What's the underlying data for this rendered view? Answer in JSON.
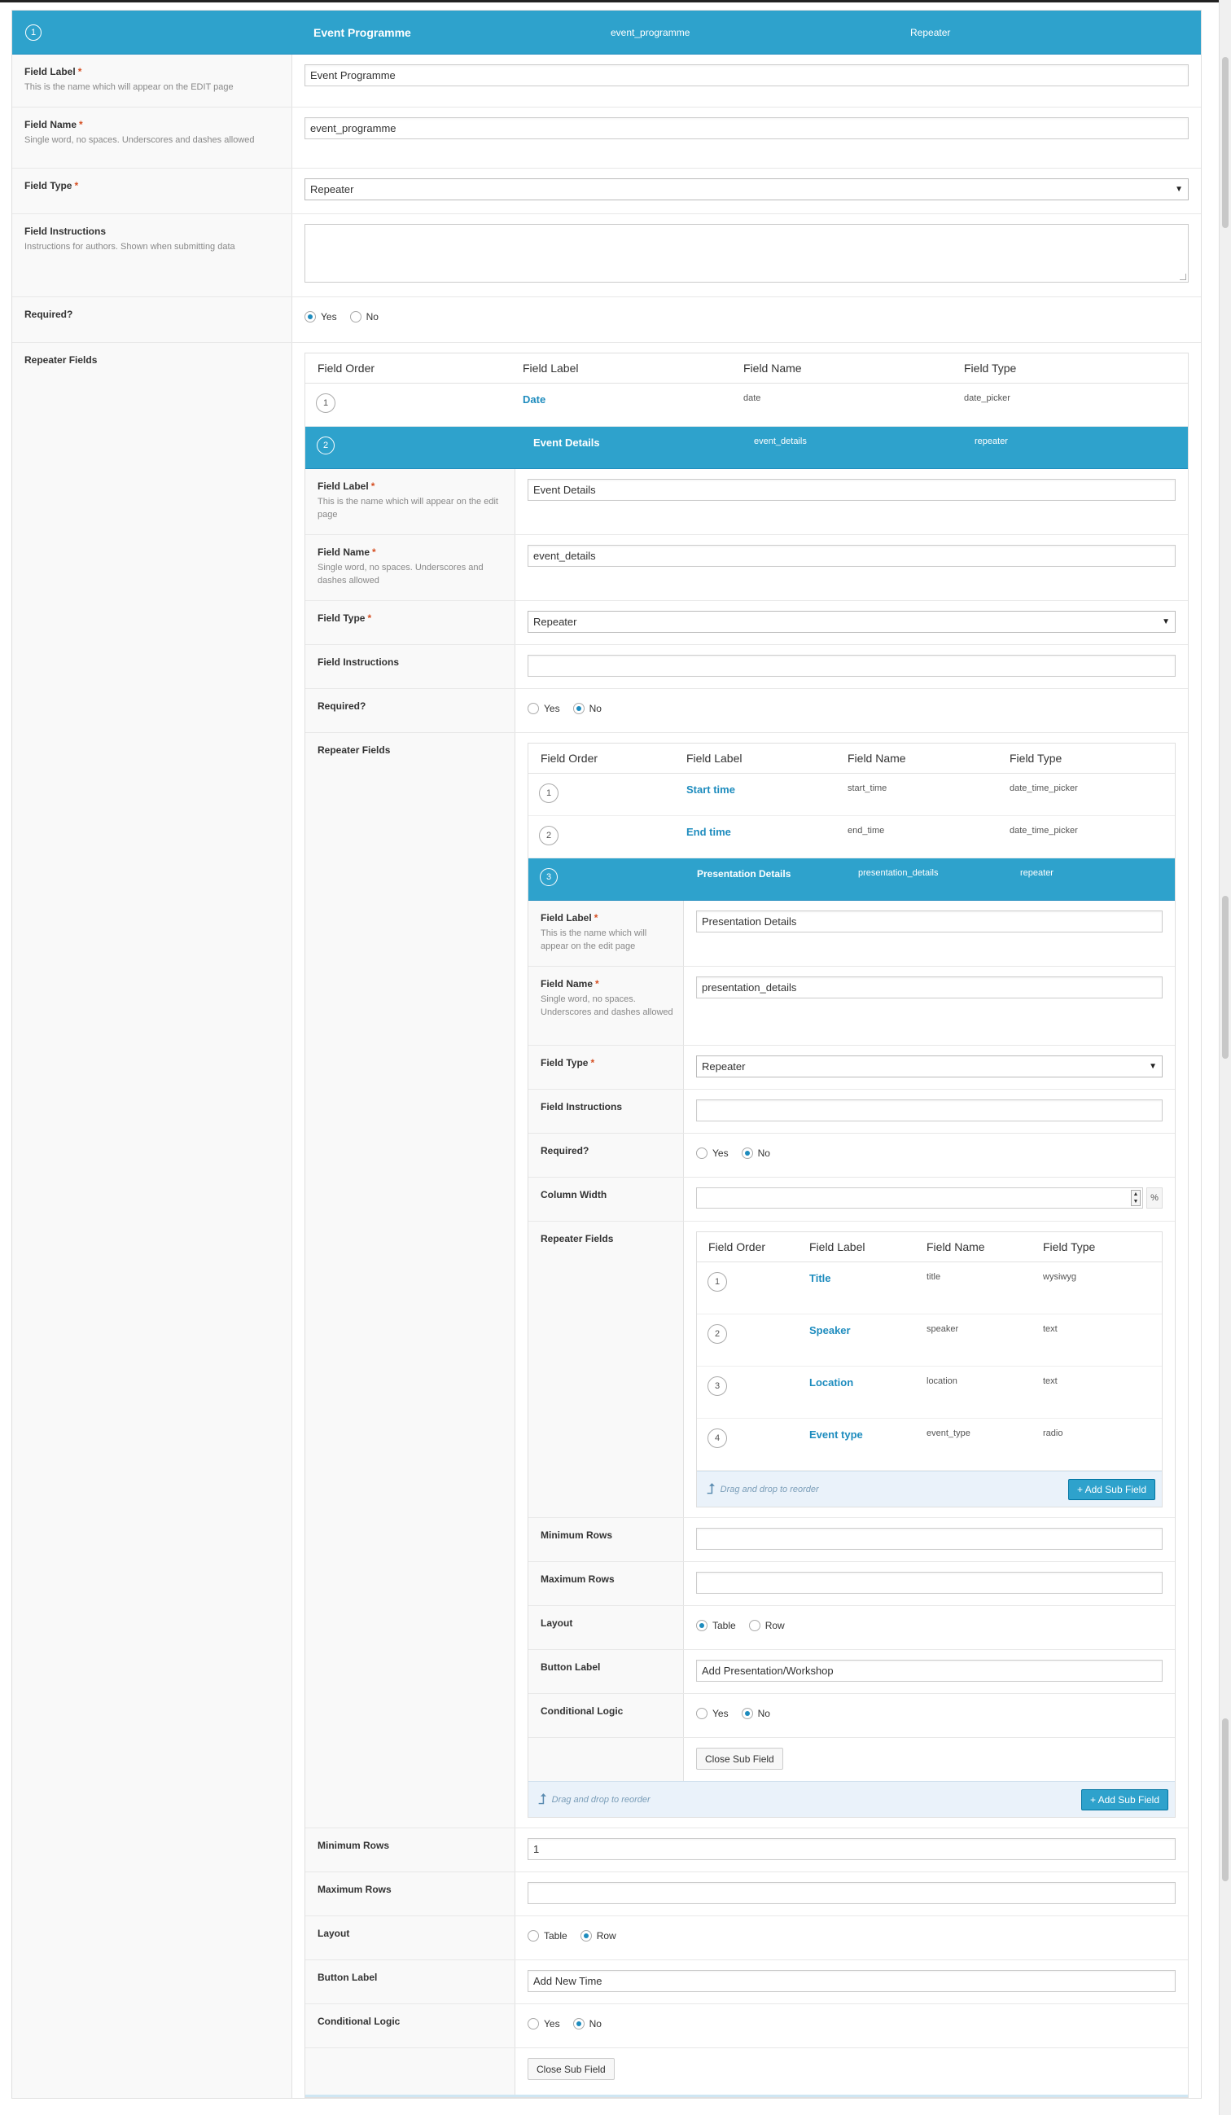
{
  "main": {
    "order": "1",
    "label": "Event Programme",
    "name": "event_programme",
    "type": "Repeater",
    "field_label": {
      "title": "Field Label",
      "desc": "This is the name which will appear on the EDIT page",
      "value": "Event Programme"
    },
    "field_name": {
      "title": "Field Name",
      "desc": "Single word, no spaces. Underscores and dashes allowed",
      "value": "event_programme"
    },
    "field_type": {
      "title": "Field Type",
      "value": "Repeater"
    },
    "field_instructions": {
      "title": "Field Instructions",
      "desc": "Instructions for authors. Shown when submitting data",
      "value": ""
    },
    "required": {
      "title": "Required?",
      "yes": "Yes",
      "no": "No",
      "selected": "Yes"
    },
    "repeater_fields_title": "Repeater Fields"
  },
  "table_headers": {
    "order": "Field Order",
    "label": "Field Label",
    "name": "Field Name",
    "type": "Field Type"
  },
  "level1_fields": [
    {
      "order": "1",
      "label": "Date",
      "name": "date",
      "type": "date_picker"
    }
  ],
  "event_details": {
    "order": "2",
    "label": "Event Details",
    "name": "event_details",
    "type": "repeater",
    "field_label": {
      "title": "Field Label",
      "desc": "This is the name which will appear on the edit page",
      "value": "Event Details"
    },
    "field_name": {
      "title": "Field Name",
      "desc": "Single word, no spaces. Underscores and dashes allowed",
      "value": "event_details"
    },
    "field_type": {
      "title": "Field Type",
      "value": "Repeater"
    },
    "field_instructions": {
      "title": "Field Instructions",
      "value": ""
    },
    "required": {
      "title": "Required?",
      "yes": "Yes",
      "no": "No",
      "selected": "No"
    },
    "repeater_fields_title": "Repeater Fields",
    "sub_fields": [
      {
        "order": "1",
        "label": "Start time",
        "name": "start_time",
        "type": "date_time_picker"
      },
      {
        "order": "2",
        "label": "End time",
        "name": "end_time",
        "type": "date_time_picker"
      }
    ],
    "min_rows": {
      "title": "Minimum Rows",
      "value": "1"
    },
    "max_rows": {
      "title": "Maximum Rows",
      "value": ""
    },
    "layout": {
      "title": "Layout",
      "table": "Table",
      "row": "Row",
      "selected": "Row"
    },
    "button_label": {
      "title": "Button Label",
      "value": "Add New Time"
    },
    "conditional": {
      "title": "Conditional Logic",
      "yes": "Yes",
      "no": "No",
      "selected": "No"
    },
    "close_btn": "Close Sub Field",
    "drag_hint": "Drag and drop to reorder",
    "add_btn": "+ Add Sub Field"
  },
  "presentation": {
    "order": "3",
    "label": "Presentation Details",
    "name": "presentation_details",
    "type": "repeater",
    "field_label": {
      "title": "Field Label",
      "desc": "This is the name which will appear on the edit page",
      "value": "Presentation Details"
    },
    "field_name": {
      "title": "Field Name",
      "desc": "Single word, no spaces. Underscores and dashes allowed",
      "value": "presentation_details"
    },
    "field_type": {
      "title": "Field Type",
      "value": "Repeater"
    },
    "field_instructions": {
      "title": "Field Instructions",
      "value": ""
    },
    "required": {
      "title": "Required?",
      "yes": "Yes",
      "no": "No",
      "selected": "No"
    },
    "column_width": {
      "title": "Column Width",
      "value": "",
      "unit": "%"
    },
    "repeater_fields_title": "Repeater Fields",
    "sub_fields": [
      {
        "order": "1",
        "label": "Title",
        "name": "title",
        "type": "wysiwyg"
      },
      {
        "order": "2",
        "label": "Speaker",
        "name": "speaker",
        "type": "text"
      },
      {
        "order": "3",
        "label": "Location",
        "name": "location",
        "type": "text"
      },
      {
        "order": "4",
        "label": "Event type",
        "name": "event_type",
        "type": "radio"
      }
    ],
    "drag_hint": "Drag and drop to reorder",
    "add_btn": "+ Add Sub Field",
    "min_rows": {
      "title": "Minimum Rows",
      "value": ""
    },
    "max_rows": {
      "title": "Maximum Rows",
      "value": ""
    },
    "layout": {
      "title": "Layout",
      "table": "Table",
      "row": "Row",
      "selected": "Table"
    },
    "button_label": {
      "title": "Button Label",
      "value": "Add Presentation/Workshop"
    },
    "conditional": {
      "title": "Conditional Logic",
      "yes": "Yes",
      "no": "No",
      "selected": "No"
    },
    "close_btn": "Close Sub Field"
  }
}
